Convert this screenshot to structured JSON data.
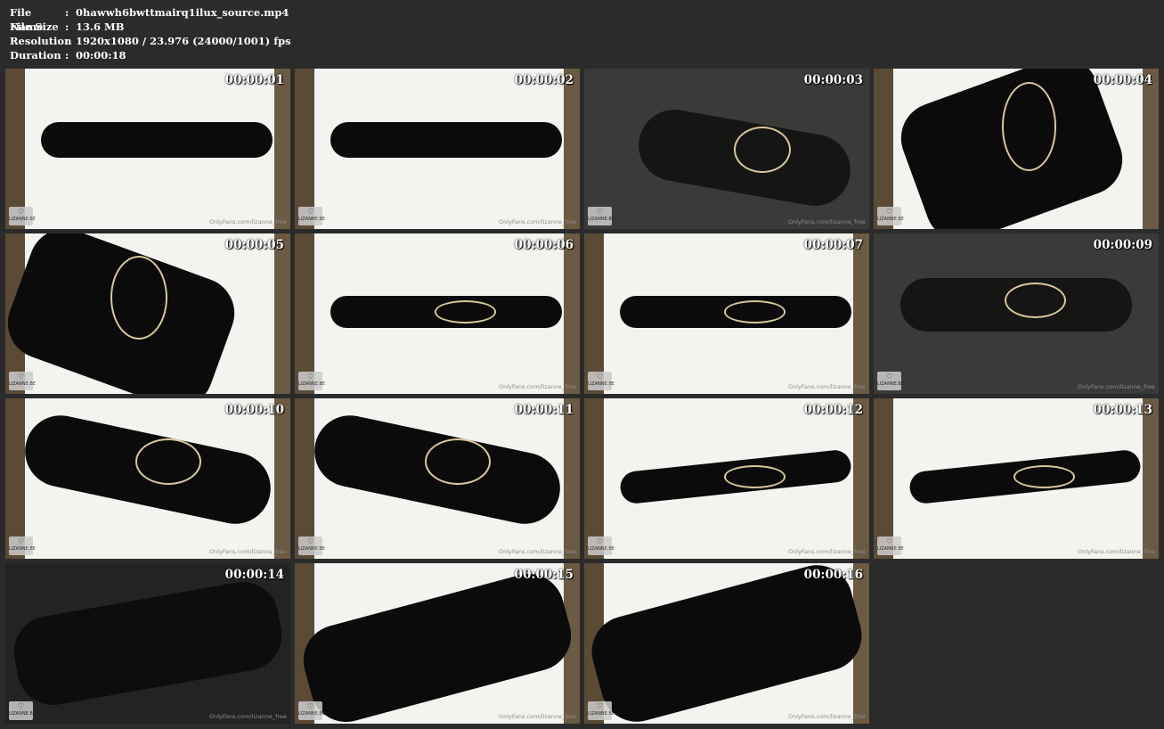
{
  "file_info": {
    "rows": [
      {
        "label": "File Name",
        "sep": ":",
        "value": "0hawwh6bwttmairq1ilux_source.mp4"
      },
      {
        "label": "File Size",
        "sep": ":",
        "value": "13.6 MB"
      },
      {
        "label": "Resolution",
        "sep": ":",
        "value": "1920x1080 / 23.976 (24000/1001) fps"
      },
      {
        "label": "Duration",
        "sep": ":",
        "value": "00:00:18"
      }
    ]
  },
  "thumbnails": [
    {
      "timestamp": "00:00:01",
      "tone": "light",
      "watermark": "OnlyFans.com/lizanne_free",
      "logo": "LIZANNE.BE"
    },
    {
      "timestamp": "00:00:02",
      "tone": "light",
      "watermark": "OnlyFans.com/lizanne_free",
      "logo": "LIZANNE.BE"
    },
    {
      "timestamp": "00:00:03",
      "tone": "dim",
      "watermark": "OnlyFans.com/lizanne_free",
      "logo": "LIZANNE.BE"
    },
    {
      "timestamp": "00:00:04",
      "tone": "light",
      "watermark": "",
      "logo": "LIZANNE.BE"
    },
    {
      "timestamp": "00:00:05",
      "tone": "light",
      "watermark": "",
      "logo": "LIZANNE.BE"
    },
    {
      "timestamp": "00:00:06",
      "tone": "light",
      "watermark": "OnlyFans.com/lizanne_free",
      "logo": "LIZANNE.BE"
    },
    {
      "timestamp": "00:00:07",
      "tone": "light",
      "watermark": "OnlyFans.com/lizanne_free",
      "logo": "LIZANNE.BE"
    },
    {
      "timestamp": "00:00:09",
      "tone": "dim",
      "watermark": "OnlyFans.com/lizanne_free",
      "logo": "LIZANNE.BE"
    },
    {
      "timestamp": "00:00:10",
      "tone": "light",
      "watermark": "OnlyFans.com/lizanne_free",
      "logo": "LIZANNE.BE"
    },
    {
      "timestamp": "00:00:11",
      "tone": "light",
      "watermark": "OnlyFans.com/lizanne_free",
      "logo": "LIZANNE.BE"
    },
    {
      "timestamp": "00:00:12",
      "tone": "light",
      "watermark": "OnlyFans.com/lizanne_free",
      "logo": "LIZANNE.BE"
    },
    {
      "timestamp": "00:00:13",
      "tone": "light",
      "watermark": "OnlyFans.com/lizanne_free",
      "logo": "LIZANNE.BE"
    },
    {
      "timestamp": "00:00:14",
      "tone": "dark",
      "watermark": "OnlyFans.com/lizanne_free",
      "logo": "LIZANNE.BE"
    },
    {
      "timestamp": "00:00:15",
      "tone": "light",
      "watermark": "OnlyFans.com/lizanne_free",
      "logo": "LIZANNE.BE"
    },
    {
      "timestamp": "00:00:16",
      "tone": "light",
      "watermark": "OnlyFans.com/lizanne_free",
      "logo": "LIZANNE.BE"
    }
  ],
  "colors": {
    "background": "#2b2b2b",
    "text": "#ffffff",
    "rope": "#d8c79a"
  }
}
